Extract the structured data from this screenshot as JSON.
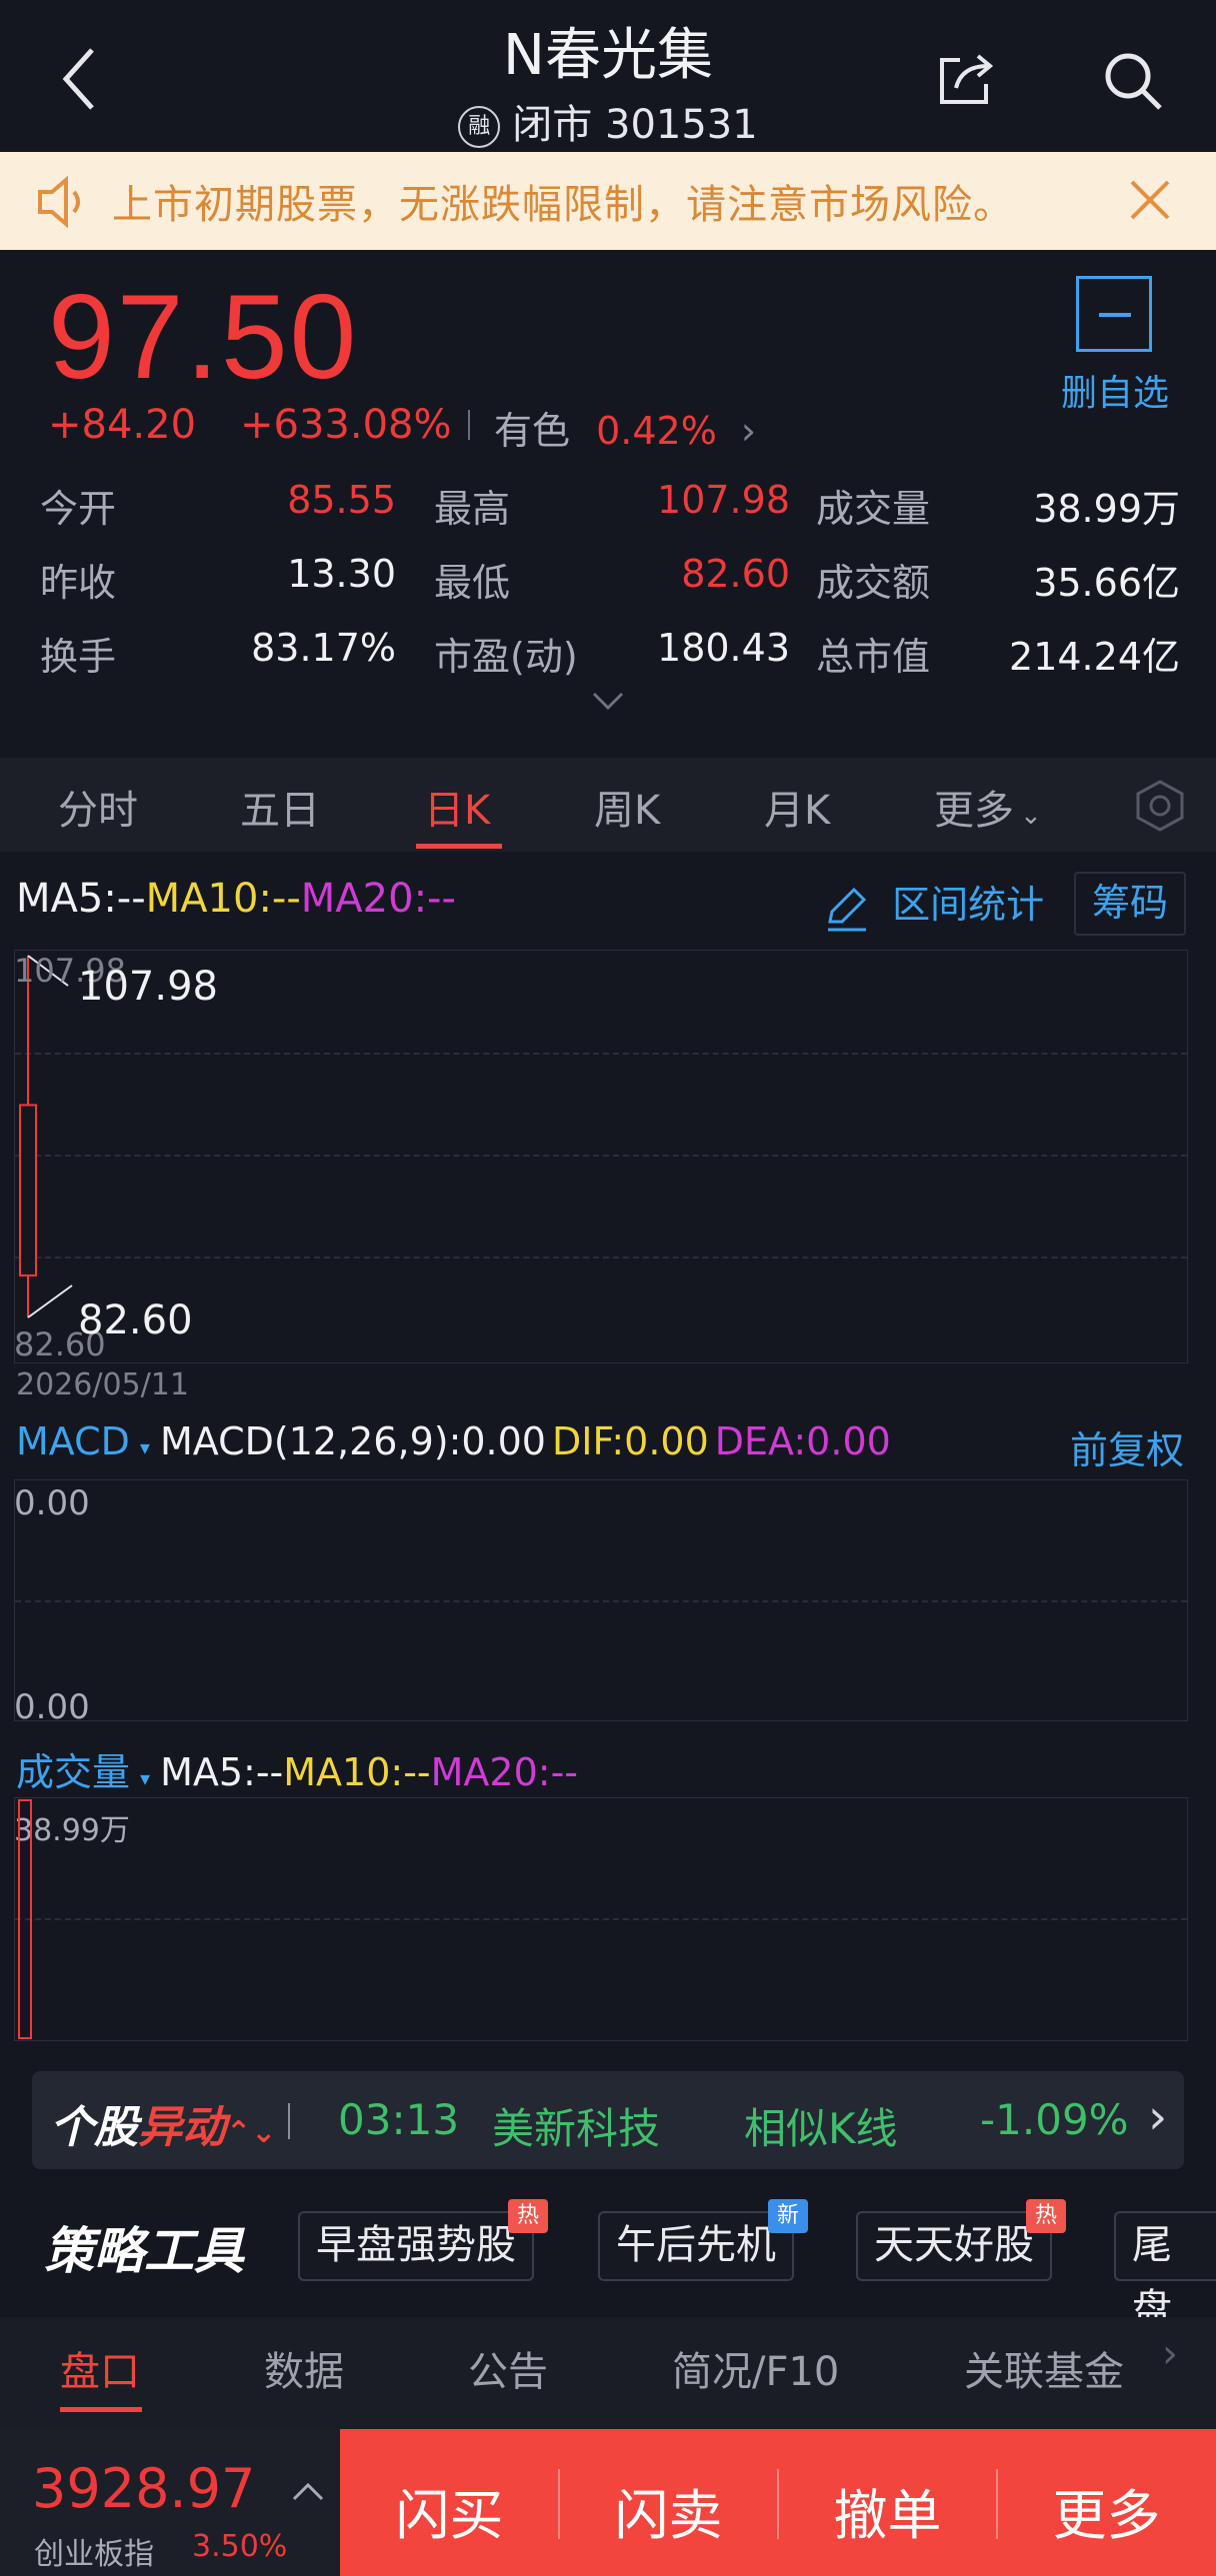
{
  "header": {
    "title": "N春光集",
    "rong_badge": "融",
    "status": "闭市",
    "code": "301531"
  },
  "notice": {
    "text": "上市初期股票，无涨跌幅限制，请注意市场风险。"
  },
  "quote": {
    "price": "97.50",
    "change": "+84.20",
    "change_pct": "+633.08%",
    "sector_name": "有色",
    "sector_pct": "0.42%",
    "remove_watch_label": "删自选",
    "stats": [
      {
        "label": "今开",
        "value": "85.55",
        "color": "#f03a3a"
      },
      {
        "label": "最高",
        "value": "107.98",
        "color": "#f03a3a"
      },
      {
        "label": "成交量",
        "value": "38.99万",
        "color": "#f0f1f4"
      },
      {
        "label": "昨收",
        "value": "13.30",
        "color": "#f0f1f4"
      },
      {
        "label": "最低",
        "value": "82.60",
        "color": "#f03a3a"
      },
      {
        "label": "成交额",
        "value": "35.66亿",
        "color": "#f0f1f4"
      },
      {
        "label": "换手",
        "value": "83.17%",
        "color": "#f0f1f4"
      },
      {
        "label": "市盈(动)",
        "value": "180.43",
        "color": "#f0f1f4"
      },
      {
        "label": "总市值",
        "value": "214.24亿",
        "color": "#f0f1f4"
      }
    ]
  },
  "chart_tabs": [
    {
      "label": "分时"
    },
    {
      "label": "五日"
    },
    {
      "label": "日K",
      "active": true
    },
    {
      "label": "周K"
    },
    {
      "label": "月K"
    },
    {
      "label": "更多"
    }
  ],
  "kline": {
    "ma5": "MA5:--",
    "ma10": "MA10:--",
    "ma20": "MA20:--",
    "range_stat_label": "区间统计",
    "chips_label": "筹码",
    "axis_high": "107.98",
    "axis_low": "82.60",
    "high_label": "107.98",
    "low_label": "82.60",
    "date": "2026/05/11"
  },
  "macd": {
    "name": "MACD",
    "params": "MACD(12,26,9):0.00",
    "dif": "DIF:0.00",
    "dea": "DEA:0.00",
    "adjust_label": "前复权",
    "axis_top": "0.00",
    "axis_bottom": "0.00"
  },
  "volume": {
    "name": "成交量",
    "ma5": "MA5:--",
    "ma10": "MA10:--",
    "ma20": "MA20:--",
    "axis_top": "38.99万"
  },
  "chart_data": {
    "type": "candlestick",
    "date": "2026/05/11",
    "open": 85.55,
    "high": 107.98,
    "low": 82.6,
    "close": 97.5,
    "volume_label": "38.99万",
    "ylim": [
      82.6,
      107.98
    ]
  },
  "alert": {
    "logo_a": "个股",
    "logo_b": "异动",
    "time": "03:13",
    "stock": "美新科技",
    "tag": "相似K线",
    "pct": "-1.09%"
  },
  "strategy": {
    "title": "策略工具",
    "chips": [
      {
        "label": "早盘强势股",
        "badge": "热",
        "badge_color": "#f0564e"
      },
      {
        "label": "午后先机",
        "badge": "新",
        "badge_color": "#3b8fea"
      },
      {
        "label": "天天好股",
        "badge": "热",
        "badge_color": "#f0564e"
      },
      {
        "label": "尾盘"
      }
    ]
  },
  "bottom_tabs": [
    {
      "label": "盘口",
      "active": true
    },
    {
      "label": "数据"
    },
    {
      "label": "公告"
    },
    {
      "label": "简况/F10"
    },
    {
      "label": "关联基金"
    }
  ],
  "index": {
    "value": "3928.97",
    "name": "创业板指",
    "pct": "3.50%"
  },
  "actions": [
    "闪买",
    "闪卖",
    "撤单",
    "更多"
  ],
  "colors": {
    "up": "#f03a3a",
    "accent_blue": "#3ea3ef",
    "ma10": "#f2d53c",
    "ma20": "#d23ad6",
    "green": "#3fbf6a"
  }
}
